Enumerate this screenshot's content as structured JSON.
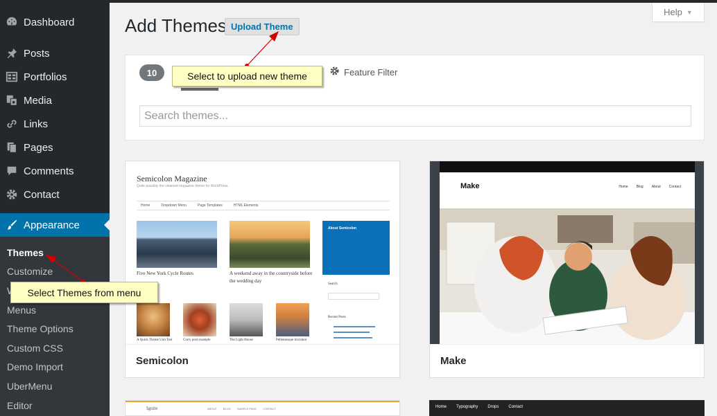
{
  "sidebar": {
    "items": [
      {
        "label": "Dashboard",
        "icon": "dashboard-icon"
      },
      {
        "label": "Posts",
        "icon": "pin-icon"
      },
      {
        "label": "Portfolios",
        "icon": "grid-icon"
      },
      {
        "label": "Media",
        "icon": "media-icon"
      },
      {
        "label": "Links",
        "icon": "link-icon"
      },
      {
        "label": "Pages",
        "icon": "pages-icon"
      },
      {
        "label": "Comments",
        "icon": "comment-icon"
      },
      {
        "label": "Contact",
        "icon": "gear-icon"
      },
      {
        "label": "Appearance",
        "icon": "brush-icon"
      }
    ],
    "submenu": [
      "Themes",
      "Customize",
      "W",
      "Menus",
      "Theme Options",
      "Custom CSS",
      "Demo Import",
      "UberMenu",
      "Editor"
    ]
  },
  "header": {
    "title": "Add Themes",
    "upload_label": "Upload Theme",
    "help_label": "Help"
  },
  "filter": {
    "count": "10",
    "feature_filter_label": "Feature Filter",
    "search_placeholder": "Search themes..."
  },
  "themes": [
    {
      "name": "Semicolon"
    },
    {
      "name": "Make"
    }
  ],
  "semicolon_preview": {
    "brand": "Semicolon Magazine",
    "tagline": "Quite possibly the cleanest magazine theme for WordPress.",
    "nav": [
      "Home",
      "Dropdown Menu",
      "Page Templates",
      "HTML Elements"
    ],
    "captions": [
      "Five New York Cycle Routes",
      "A weekend away in the countryside before the wedding day"
    ],
    "small_captions": [
      "A Quick Theme Unit Test",
      "Curry post example",
      "The Light House",
      "Pellentesque tincidunt"
    ],
    "sidebar_title": "About Semicolon",
    "search_title": "Search",
    "recent_title": "Recent Posts"
  },
  "make_preview": {
    "logo": "Make",
    "nav": [
      "Home",
      "Blog",
      "About",
      "Contact"
    ]
  },
  "bottom_peeks": {
    "left_brand": "Ignite",
    "left_nav": [
      "ABOUT",
      "BLOG",
      "SAMPLE PAGE",
      "CONTACT"
    ],
    "right_nav": [
      "Home",
      "Typography",
      "Drops",
      "Contact"
    ]
  },
  "callouts": {
    "upload": "Select to upload new theme",
    "themes": "Select Themes from menu"
  },
  "colors": {
    "sidebar_bg": "#23282d",
    "submenu_bg": "#32373c",
    "accent": "#0073aa",
    "callout_bg": "#ffffc4",
    "arrow": "#d40000"
  }
}
